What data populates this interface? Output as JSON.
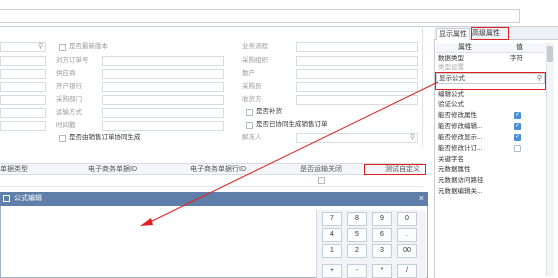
{
  "form": {
    "col1": [
      {
        "label": "",
        "y": 0
      },
      {
        "label": "",
        "y": 1
      },
      {
        "label": "供应商",
        "y": 2
      },
      {
        "label": "开户银行",
        "y": 3
      },
      {
        "label": "采购部门",
        "y": 4
      },
      {
        "label": "运输方式",
        "y": 5
      },
      {
        "label": "时间戳",
        "y": 6
      }
    ],
    "check_latest_version": "是否最新版本",
    "counter_order_no": "对方订单号",
    "col3_labels": [
      "业务流程",
      "采购组织",
      "散户",
      "采购员",
      "收货方",
      "",
      "",
      "",
      "解冻人"
    ],
    "check_supplement": "是否补货",
    "check_sales_coop": "是否已协同生成销售订单",
    "check_from_sales": "是否由销售订单协同生成"
  },
  "grid": {
    "headers": [
      "单据类型",
      "电子商务单据ID",
      "电子商务单据行ID",
      "是否运输关闭",
      "测试自定义"
    ]
  },
  "dialog": {
    "title": "公式编辑",
    "close": "×",
    "keys": [
      "7",
      "8",
      "9",
      "0",
      "4",
      "5",
      "6",
      ".",
      "1",
      "2",
      "3",
      "00",
      "+",
      "-",
      "*",
      "/"
    ]
  },
  "panel": {
    "tab_display": "显示属性",
    "tab_advanced": "高级属性",
    "col_prop": "属性",
    "col_value": "值",
    "rows": [
      {
        "name": "数据类型",
        "value": "字符",
        "check": null
      },
      {
        "name": "类型设置",
        "value": "",
        "check": null
      },
      {
        "name": "显示公式",
        "value": "",
        "check": null
      },
      {
        "name": "编辑公式",
        "value": "",
        "check": null
      },
      {
        "name": "验证公式",
        "value": "",
        "check": null
      },
      {
        "name": "能否修改属性",
        "value": "",
        "check": true
      },
      {
        "name": "能否修改编辑...",
        "value": "",
        "check": true
      },
      {
        "name": "能否修改显示...",
        "value": "",
        "check": true
      },
      {
        "name": "能否修改计订...",
        "value": "",
        "check": false
      },
      {
        "name": "关键字名",
        "value": "",
        "check": null
      },
      {
        "name": "元数据属性",
        "value": "",
        "check": null
      },
      {
        "name": "元数据访问路径",
        "value": "",
        "check": null
      },
      {
        "name": "元数据编辑关...",
        "value": "",
        "check": null
      }
    ]
  },
  "colors": {
    "accent": "#4a90d9",
    "dialog_title": "#5f7fa8",
    "highlight": "#e02020"
  }
}
